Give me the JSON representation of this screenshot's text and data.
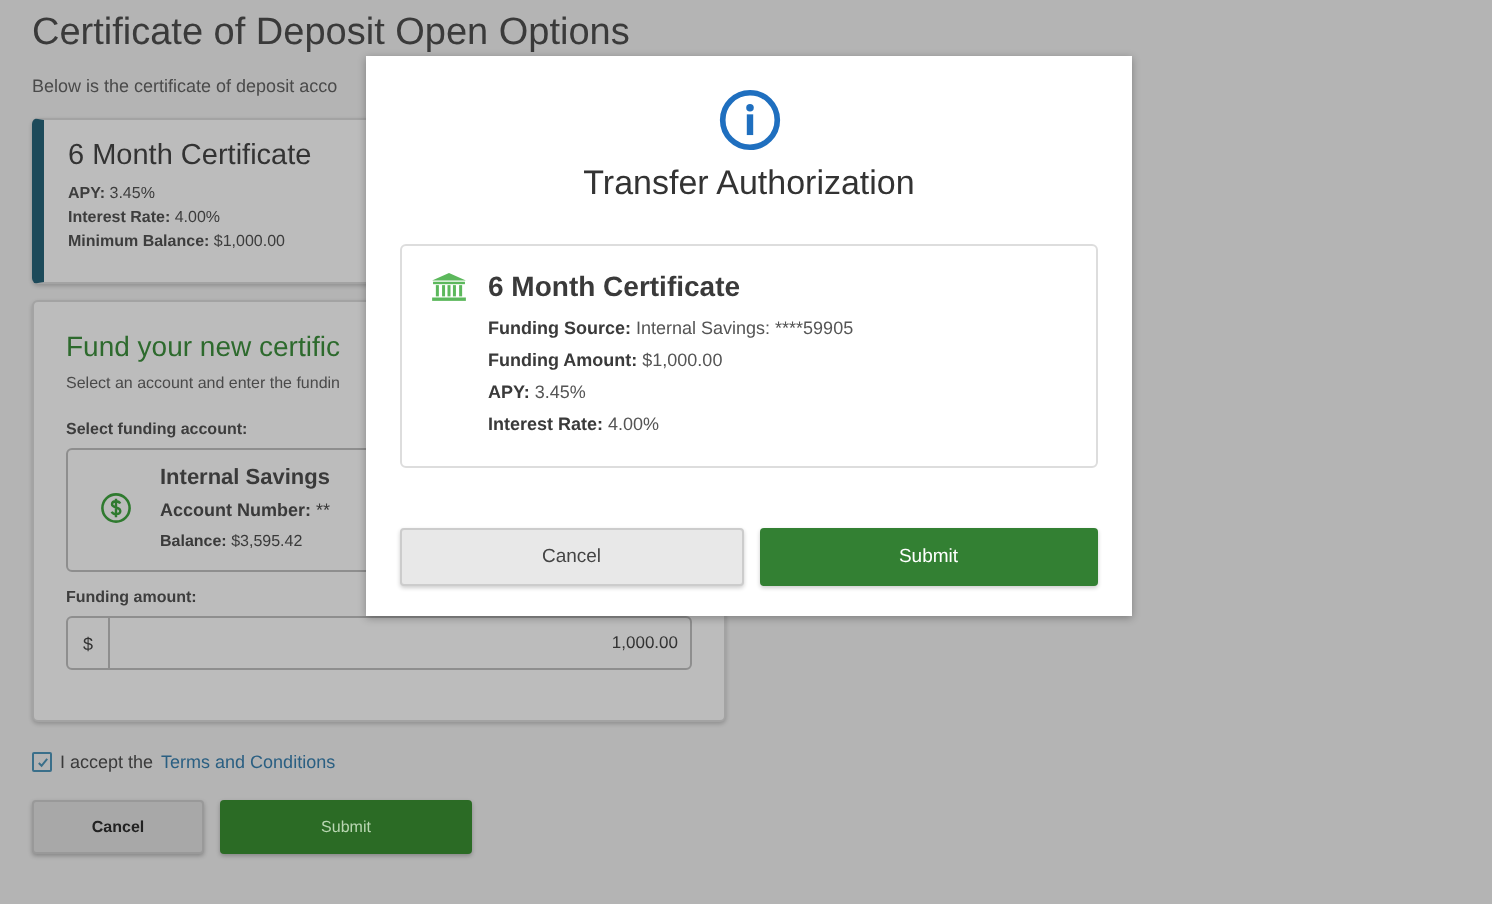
{
  "page": {
    "title": "Certificate of Deposit Open Options",
    "subtitle": "Below is the certificate of deposit acco"
  },
  "certificate": {
    "name": "6 Month Certificate",
    "details": [
      {
        "label": "APY:",
        "value": "3.45%"
      },
      {
        "label": "Interest Rate:",
        "value": "4.00%"
      },
      {
        "label": "Minimum Balance:",
        "value": "$1,000.00"
      }
    ]
  },
  "funding": {
    "heading": "Fund your new certific",
    "instructions": "Select an account and enter the fundin",
    "account_label": "Select funding account:",
    "account": {
      "name": "Internal Savings",
      "details": [
        {
          "label": "Account Number:",
          "value": "**"
        },
        {
          "label": "Balance:",
          "value": "$3,595.42"
        }
      ]
    },
    "amount_label": "Funding amount:",
    "currency": "$",
    "amount": "1,000.00"
  },
  "terms": {
    "checked": true,
    "text": "I accept the",
    "link": "Terms and Conditions"
  },
  "buttons": [
    {
      "kind": "secondary",
      "label": "Cancel"
    },
    {
      "kind": "primary",
      "label": "Submit"
    }
  ],
  "modal": {
    "title": "Transfer Authorization",
    "summary": {
      "name": "6 Month Certificate",
      "details": [
        {
          "label": "Funding Source:",
          "value": "Internal Savings: ****59905"
        },
        {
          "label": "Funding Amount:",
          "value": "$1,000.00"
        },
        {
          "label": "APY:",
          "value": "3.45%"
        },
        {
          "label": "Interest Rate:",
          "value": "4.00%"
        }
      ]
    },
    "buttons": [
      {
        "kind": "secondary",
        "label": "Cancel"
      },
      {
        "kind": "primary",
        "label": "Submit"
      }
    ]
  }
}
